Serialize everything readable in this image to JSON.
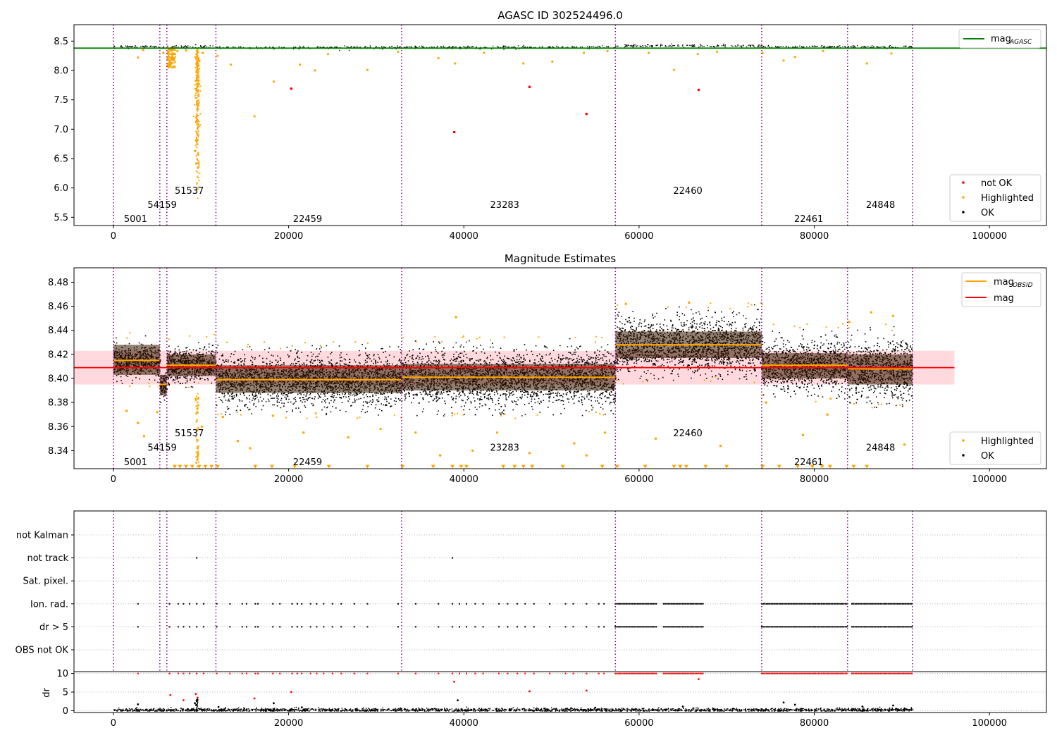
{
  "chart_data": [
    {
      "type": "scatter",
      "title": "AGASC ID 302524496.0",
      "xlim": [
        -4500,
        106500
      ],
      "ylim": [
        5.36,
        8.78
      ],
      "xticks": [
        0,
        20000,
        40000,
        60000,
        80000,
        100000
      ],
      "yticks": [
        5.5,
        6.0,
        6.5,
        7.0,
        7.5,
        8.0,
        8.5
      ],
      "ytick_labels": [
        "5.5",
        "6.0",
        "6.5",
        "7.0",
        "7.5",
        "8.0",
        "8.5"
      ],
      "xtick_labels": [
        "0",
        "20000",
        "40000",
        "60000",
        "80000",
        "100000"
      ],
      "colors": {
        "ok": "#000000",
        "highlighted": "#ffa500",
        "not_ok": "#ff0000",
        "mag_agasc": "#008000",
        "obsid_lines": "#800080"
      },
      "mag_agasc": 8.38,
      "legend_position": "top-right / lower-right",
      "legend_top": [
        {
          "label": "mag",
          "sub": "AGASC",
          "color": "#008000"
        }
      ],
      "legend_bottom": [
        {
          "label": "not OK",
          "color": "#ff0000"
        },
        {
          "label": "Highlighted",
          "color": "#ffa500"
        },
        {
          "label": "OK",
          "color": "#000000"
        }
      ],
      "obsid_boundaries": [
        0,
        5300,
        6100,
        11700,
        32900,
        57300,
        74000,
        83800,
        91200
      ],
      "obsid_labels": [
        {
          "text": "5001",
          "x": 1200,
          "y": 5.48
        },
        {
          "text": "54159",
          "x": 3900,
          "y": 5.72
        },
        {
          "text": "51537",
          "x": 7000,
          "y": 5.96
        },
        {
          "text": "22459",
          "x": 20500,
          "y": 5.48
        },
        {
          "text": "23283",
          "x": 43000,
          "y": 5.72
        },
        {
          "text": "22460",
          "x": 63900,
          "y": 5.96
        },
        {
          "text": "22461",
          "x": 77700,
          "y": 5.48
        },
        {
          "text": "24848",
          "x": 85900,
          "y": 5.72
        }
      ],
      "ok_segments": [
        {
          "x0": 0,
          "x1": 5300,
          "y": 8.415
        },
        {
          "x0": 5300,
          "x1": 6100,
          "y": 8.395
        },
        {
          "x0": 6100,
          "x1": 11700,
          "y": 8.411
        },
        {
          "x0": 11700,
          "x1": 32900,
          "y": 8.399
        },
        {
          "x0": 32900,
          "x1": 57300,
          "y": 8.401
        },
        {
          "x0": 57300,
          "x1": 74000,
          "y": 8.428
        },
        {
          "x0": 74000,
          "x1": 83800,
          "y": 8.411
        },
        {
          "x0": 83800,
          "x1": 91200,
          "y": 8.408
        }
      ],
      "not_ok_points": [
        {
          "x": 20300,
          "y": 7.69
        },
        {
          "x": 38900,
          "y": 6.95
        },
        {
          "x": 47500,
          "y": 7.72
        },
        {
          "x": 54000,
          "y": 7.26
        },
        {
          "x": 66800,
          "y": 7.67
        }
      ],
      "highlighted_points": [
        {
          "x": 2800,
          "y": 8.22
        },
        {
          "x": 3400,
          "y": 8.35
        },
        {
          "x": 5700,
          "y": 8.3
        },
        {
          "x": 6200,
          "y": 8.2
        },
        {
          "x": 6500,
          "y": 8.1
        },
        {
          "x": 7300,
          "y": 8.33
        },
        {
          "x": 8300,
          "y": 8.34
        },
        {
          "x": 10200,
          "y": 8.3
        },
        {
          "x": 11900,
          "y": 8.25
        },
        {
          "x": 13400,
          "y": 8.1
        },
        {
          "x": 16100,
          "y": 7.22
        },
        {
          "x": 18300,
          "y": 7.81
        },
        {
          "x": 21300,
          "y": 8.1
        },
        {
          "x": 23000,
          "y": 8.0
        },
        {
          "x": 24500,
          "y": 8.28
        },
        {
          "x": 29000,
          "y": 8.01
        },
        {
          "x": 32500,
          "y": 8.32
        },
        {
          "x": 37100,
          "y": 8.21
        },
        {
          "x": 39000,
          "y": 8.12
        },
        {
          "x": 42300,
          "y": 8.3
        },
        {
          "x": 46800,
          "y": 8.12
        },
        {
          "x": 50100,
          "y": 8.15
        },
        {
          "x": 53700,
          "y": 8.3
        },
        {
          "x": 56400,
          "y": 8.33
        },
        {
          "x": 61100,
          "y": 8.3
        },
        {
          "x": 64000,
          "y": 8.01
        },
        {
          "x": 66700,
          "y": 8.28
        },
        {
          "x": 68900,
          "y": 8.32
        },
        {
          "x": 74100,
          "y": 8.3
        },
        {
          "x": 76500,
          "y": 8.17
        },
        {
          "x": 77800,
          "y": 8.23
        },
        {
          "x": 81000,
          "y": 8.33
        },
        {
          "x": 86000,
          "y": 8.12
        },
        {
          "x": 88800,
          "y": 8.29
        }
      ],
      "dip_segment": {
        "x": 9500,
        "y_min": 5.6,
        "y_max": 8.38
      }
    },
    {
      "type": "scatter",
      "title": "Magnitude Estimates",
      "xlim": [
        -4500,
        106500
      ],
      "ylim": [
        8.325,
        8.492
      ],
      "xticks": [
        0,
        20000,
        40000,
        60000,
        80000,
        100000
      ],
      "yticks": [
        8.34,
        8.36,
        8.38,
        8.4,
        8.42,
        8.44,
        8.46,
        8.48
      ],
      "ytick_labels": [
        "8.34",
        "8.36",
        "8.38",
        "8.40",
        "8.42",
        "8.44",
        "8.46",
        "8.48"
      ],
      "xtick_labels": [
        "0",
        "20000",
        "40000",
        "60000",
        "80000",
        "100000"
      ],
      "colors": {
        "mag_obsid": "#ffa500",
        "mag": "#ff0000",
        "mag_band": "#ffc0c8",
        "ok": "#000000",
        "highlighted": "#ffa500"
      },
      "mag": 8.409,
      "mag_band": [
        8.395,
        8.423
      ],
      "mag_line_xmax": 96000,
      "legend_top": [
        {
          "label": "mag",
          "sub": "OBSID",
          "color": "#ffa500"
        },
        {
          "label": "mag",
          "sub": "",
          "color": "#ff0000"
        }
      ],
      "legend_bottom": [
        {
          "label": "Highlighted",
          "color": "#ffa500"
        },
        {
          "label": "OK",
          "color": "#000000"
        }
      ],
      "obsid_labels": [
        {
          "text": "5001",
          "x": 1200,
          "y": 8.331
        },
        {
          "text": "54159",
          "x": 3900,
          "y": 8.343
        },
        {
          "text": "51537",
          "x": 7000,
          "y": 8.355
        },
        {
          "text": "22459",
          "x": 20500,
          "y": 8.331
        },
        {
          "text": "23283",
          "x": 43000,
          "y": 8.343
        },
        {
          "text": "22460",
          "x": 63900,
          "y": 8.355
        },
        {
          "text": "22461",
          "x": 77700,
          "y": 8.331
        },
        {
          "text": "24848",
          "x": 85900,
          "y": 8.343
        }
      ],
      "segments": [
        {
          "x0": 0,
          "x1": 5300,
          "mean": 8.415,
          "band": [
            8.403,
            8.428
          ],
          "lo": 8.399,
          "hi": 8.434
        },
        {
          "x0": 5300,
          "x1": 6100,
          "mean": 8.395,
          "band": [
            8.386,
            8.403
          ],
          "lo": 8.381,
          "hi": 8.409
        },
        {
          "x0": 6100,
          "x1": 11700,
          "mean": 8.411,
          "band": [
            8.402,
            8.42
          ],
          "lo": 8.397,
          "hi": 8.432
        },
        {
          "x0": 11700,
          "x1": 32900,
          "mean": 8.399,
          "band": [
            8.388,
            8.411
          ],
          "lo": 8.373,
          "hi": 8.425
        },
        {
          "x0": 32900,
          "x1": 57300,
          "mean": 8.401,
          "band": [
            8.39,
            8.412
          ],
          "lo": 8.373,
          "hi": 8.43
        },
        {
          "x0": 57300,
          "x1": 74000,
          "mean": 8.428,
          "band": [
            8.417,
            8.439
          ],
          "lo": 8.402,
          "hi": 8.458
        },
        {
          "x0": 74000,
          "x1": 83800,
          "mean": 8.411,
          "band": [
            8.4,
            8.421
          ],
          "lo": 8.387,
          "hi": 8.44
        },
        {
          "x0": 83800,
          "x1": 91200,
          "mean": 8.408,
          "band": [
            8.395,
            8.42
          ],
          "lo": 8.38,
          "hi": 8.44
        }
      ],
      "highlighted_points": [
        {
          "x": 1500,
          "y": 8.373
        },
        {
          "x": 2800,
          "y": 8.363
        },
        {
          "x": 3500,
          "y": 8.352
        },
        {
          "x": 5000,
          "y": 8.372
        },
        {
          "x": 9400,
          "y": 8.383
        },
        {
          "x": 10100,
          "y": 8.36
        },
        {
          "x": 12500,
          "y": 8.368
        },
        {
          "x": 14200,
          "y": 8.348
        },
        {
          "x": 15600,
          "y": 8.342
        },
        {
          "x": 18200,
          "y": 8.369
        },
        {
          "x": 21700,
          "y": 8.355
        },
        {
          "x": 26800,
          "y": 8.351
        },
        {
          "x": 30500,
          "y": 8.358
        },
        {
          "x": 34500,
          "y": 8.355
        },
        {
          "x": 37300,
          "y": 8.336
        },
        {
          "x": 39100,
          "y": 8.451
        },
        {
          "x": 41000,
          "y": 8.34
        },
        {
          "x": 43800,
          "y": 8.355
        },
        {
          "x": 47500,
          "y": 8.338
        },
        {
          "x": 52600,
          "y": 8.346
        },
        {
          "x": 54000,
          "y": 8.336
        },
        {
          "x": 56100,
          "y": 8.355
        },
        {
          "x": 58500,
          "y": 8.462
        },
        {
          "x": 61900,
          "y": 8.35
        },
        {
          "x": 65700,
          "y": 8.463
        },
        {
          "x": 69300,
          "y": 8.344
        },
        {
          "x": 74500,
          "y": 8.38
        },
        {
          "x": 78700,
          "y": 8.353
        },
        {
          "x": 81500,
          "y": 8.37
        },
        {
          "x": 84000,
          "y": 8.447
        },
        {
          "x": 86500,
          "y": 8.455
        },
        {
          "x": 89000,
          "y": 8.452
        },
        {
          "x": 90300,
          "y": 8.345
        }
      ],
      "floor_markers_x": [
        7000,
        7600,
        8300,
        9000,
        9800,
        10500,
        11200,
        11900,
        16200,
        18100,
        20700,
        24600,
        29000,
        33000,
        36500,
        38700,
        39700,
        40300,
        44500,
        45800,
        46800,
        47800,
        51300,
        55800,
        57500,
        60700,
        64000,
        64700,
        65400,
        67600,
        70000,
        74100,
        76000,
        78100,
        79800,
        80900,
        81800,
        84500,
        86000
      ],
      "floor_marker_y": 8.327,
      "dip_segment": {
        "x": 9500,
        "y_min": 8.327,
        "y_max": 8.39
      }
    },
    {
      "type": "scatter",
      "title": "",
      "xlim": [
        -4500,
        106500
      ],
      "categories": [
        "not Kalman",
        "not track",
        "Sat. pixel.",
        "Ion. rad.",
        "dr > 5",
        "OBS not OK"
      ],
      "flag_rows": [
        {
          "label": "not Kalman",
          "points_x": []
        },
        {
          "label": "not track",
          "points_x": [
            9500,
            38700
          ]
        },
        {
          "label": "Sat. pixel.",
          "points_x": []
        },
        {
          "label": "Ion. rad.",
          "points_x": [
            2800,
            6400,
            7400,
            8000,
            8700,
            9500,
            10300,
            11800,
            13300,
            14700,
            15200,
            16200,
            16500,
            18200,
            19000,
            20400,
            21000,
            21500,
            22500,
            23200,
            24000,
            25000,
            26000,
            27500,
            29000,
            32500,
            34500,
            37100,
            38700,
            39500,
            40300,
            41300,
            42200,
            44000,
            45000,
            46100,
            47000,
            48000,
            49800,
            51600,
            52500,
            54000,
            55400,
            56000
          ],
          "dense_ranges": [
            [
              57300,
              62000
            ],
            [
              62800,
              67300
            ],
            [
              74000,
              83800
            ],
            [
              84300,
              91200
            ]
          ]
        },
        {
          "label": "dr > 5",
          "points_x": [
            2800,
            6400,
            7400,
            8000,
            8700,
            9500,
            10300,
            11800,
            13300,
            14700,
            15200,
            16200,
            16500,
            18200,
            19000,
            20400,
            21000,
            21500,
            22500,
            23200,
            24000,
            25000,
            26000,
            27500,
            29000,
            32500,
            34500,
            37100,
            38700,
            39500,
            40300,
            41300,
            42200,
            44000,
            45000,
            46100,
            47000,
            48000,
            49800,
            51600,
            52500,
            54000,
            55400,
            56000
          ],
          "dense_ranges": [
            [
              57300,
              62000
            ],
            [
              62800,
              67300
            ],
            [
              74000,
              83800
            ],
            [
              84300,
              91200
            ]
          ]
        },
        {
          "label": "OBS not OK",
          "points_x": []
        }
      ],
      "colors": {
        "points": "#000000"
      }
    },
    {
      "type": "scatter",
      "title": "",
      "ylabel": "dr",
      "xlim": [
        -4500,
        106500
      ],
      "ylim": [
        -0.5,
        10.5
      ],
      "yticks": [
        0,
        5,
        10
      ],
      "ytick_labels": [
        "0",
        "5",
        "10"
      ],
      "xticks": [
        0,
        20000,
        40000,
        60000,
        80000,
        100000
      ],
      "xtick_labels": [
        "0",
        "20000",
        "40000",
        "60000",
        "80000",
        "100000"
      ],
      "colors": {
        "ok": "#000000",
        "not_ok": "#ff0000"
      },
      "clipped_value": 10,
      "clipped_x": [
        2800,
        6400,
        7400,
        8000,
        8700,
        9500,
        10300,
        11800,
        13300,
        14700,
        15200,
        16200,
        16500,
        18200,
        19000,
        20400,
        21000,
        21500,
        22500,
        23200,
        24000,
        25000,
        26000,
        27500,
        29000,
        32500,
        34500,
        37100,
        38700,
        39500,
        40300,
        41300,
        42200,
        44000,
        45000,
        46100,
        47000,
        48000,
        49800,
        51600,
        52500,
        54000,
        55400,
        56000
      ],
      "clipped_dense_ranges": [
        [
          57300,
          62000
        ],
        [
          62800,
          67300
        ],
        [
          74000,
          83800
        ],
        [
          84300,
          91200
        ]
      ],
      "red_points": [
        {
          "x": 6500,
          "y": 4.2
        },
        {
          "x": 8000,
          "y": 2.8
        },
        {
          "x": 9400,
          "y": 4.5
        },
        {
          "x": 9600,
          "y": 3.5
        },
        {
          "x": 16100,
          "y": 3.3
        },
        {
          "x": 20300,
          "y": 5.0
        },
        {
          "x": 38900,
          "y": 7.8
        },
        {
          "x": 47500,
          "y": 5.2
        },
        {
          "x": 54000,
          "y": 5.4
        },
        {
          "x": 66800,
          "y": 8.5
        }
      ],
      "black_points": [
        {
          "x": 2800,
          "y": 1.7
        },
        {
          "x": 9300,
          "y": 2.0
        },
        {
          "x": 9450,
          "y": 1.5
        },
        {
          "x": 12000,
          "y": 1.0
        },
        {
          "x": 18300,
          "y": 2.0
        },
        {
          "x": 21500,
          "y": 0.9
        },
        {
          "x": 39300,
          "y": 2.8
        },
        {
          "x": 55000,
          "y": 0.8
        },
        {
          "x": 65000,
          "y": 1.1
        },
        {
          "x": 76500,
          "y": 2.2
        },
        {
          "x": 77800,
          "y": 1.6
        },
        {
          "x": 85500,
          "y": 1.1
        },
        {
          "x": 89000,
          "y": 1.4
        }
      ],
      "baseline_range": [
        0,
        91200
      ],
      "baseline_value": 0.3
    }
  ]
}
